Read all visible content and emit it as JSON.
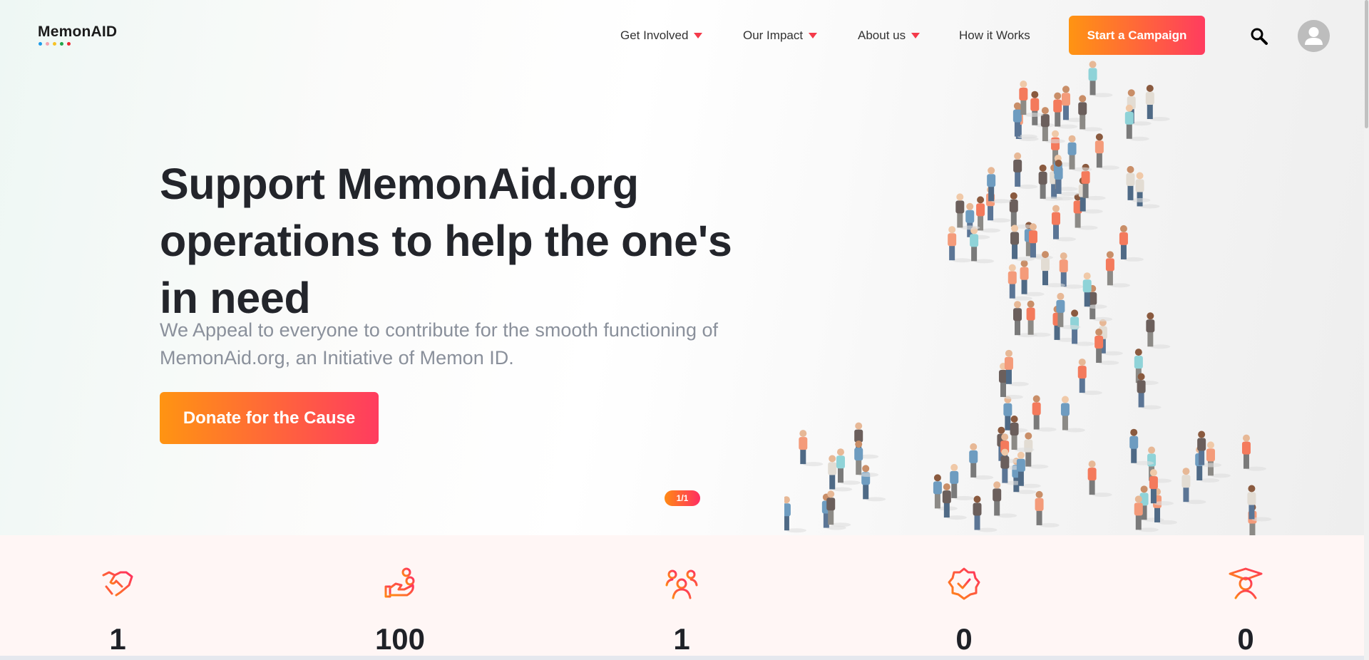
{
  "brand": {
    "name": "MemonAID",
    "dot_colors": [
      "#1e9be9",
      "#f5a3ae",
      "#f7c325",
      "#22a54a",
      "#ec2a33"
    ]
  },
  "nav": {
    "items": [
      {
        "label": "Get Involved",
        "dropdown": true
      },
      {
        "label": "Our Impact",
        "dropdown": true
      },
      {
        "label": "About us",
        "dropdown": true
      },
      {
        "label": "How it Works",
        "dropdown": false
      }
    ],
    "cta_label": "Start a Campaign",
    "search_icon": "search-icon",
    "avatar_icon": "user-avatar-icon"
  },
  "hero": {
    "title": "Support MemonAid.org operations to help the one's in need",
    "subtitle": "We Appeal to everyone to contribute for the smooth functioning of MemonAid.org, an Initiative of Memon ID.",
    "button_label": "Donate for the Cause",
    "pager": "1/1"
  },
  "stats": [
    {
      "icon": "handshake-icon",
      "value": "1"
    },
    {
      "icon": "hand-coins-icon",
      "value": "100"
    },
    {
      "icon": "users-group-icon",
      "value": "1"
    },
    {
      "icon": "verified-badge-icon",
      "value": "0"
    },
    {
      "icon": "graduate-icon",
      "value": "0"
    }
  ],
  "colors": {
    "accent_start": "#ff9412",
    "accent_end": "#ff3c5f",
    "stats_bg": "#fff6f5"
  }
}
